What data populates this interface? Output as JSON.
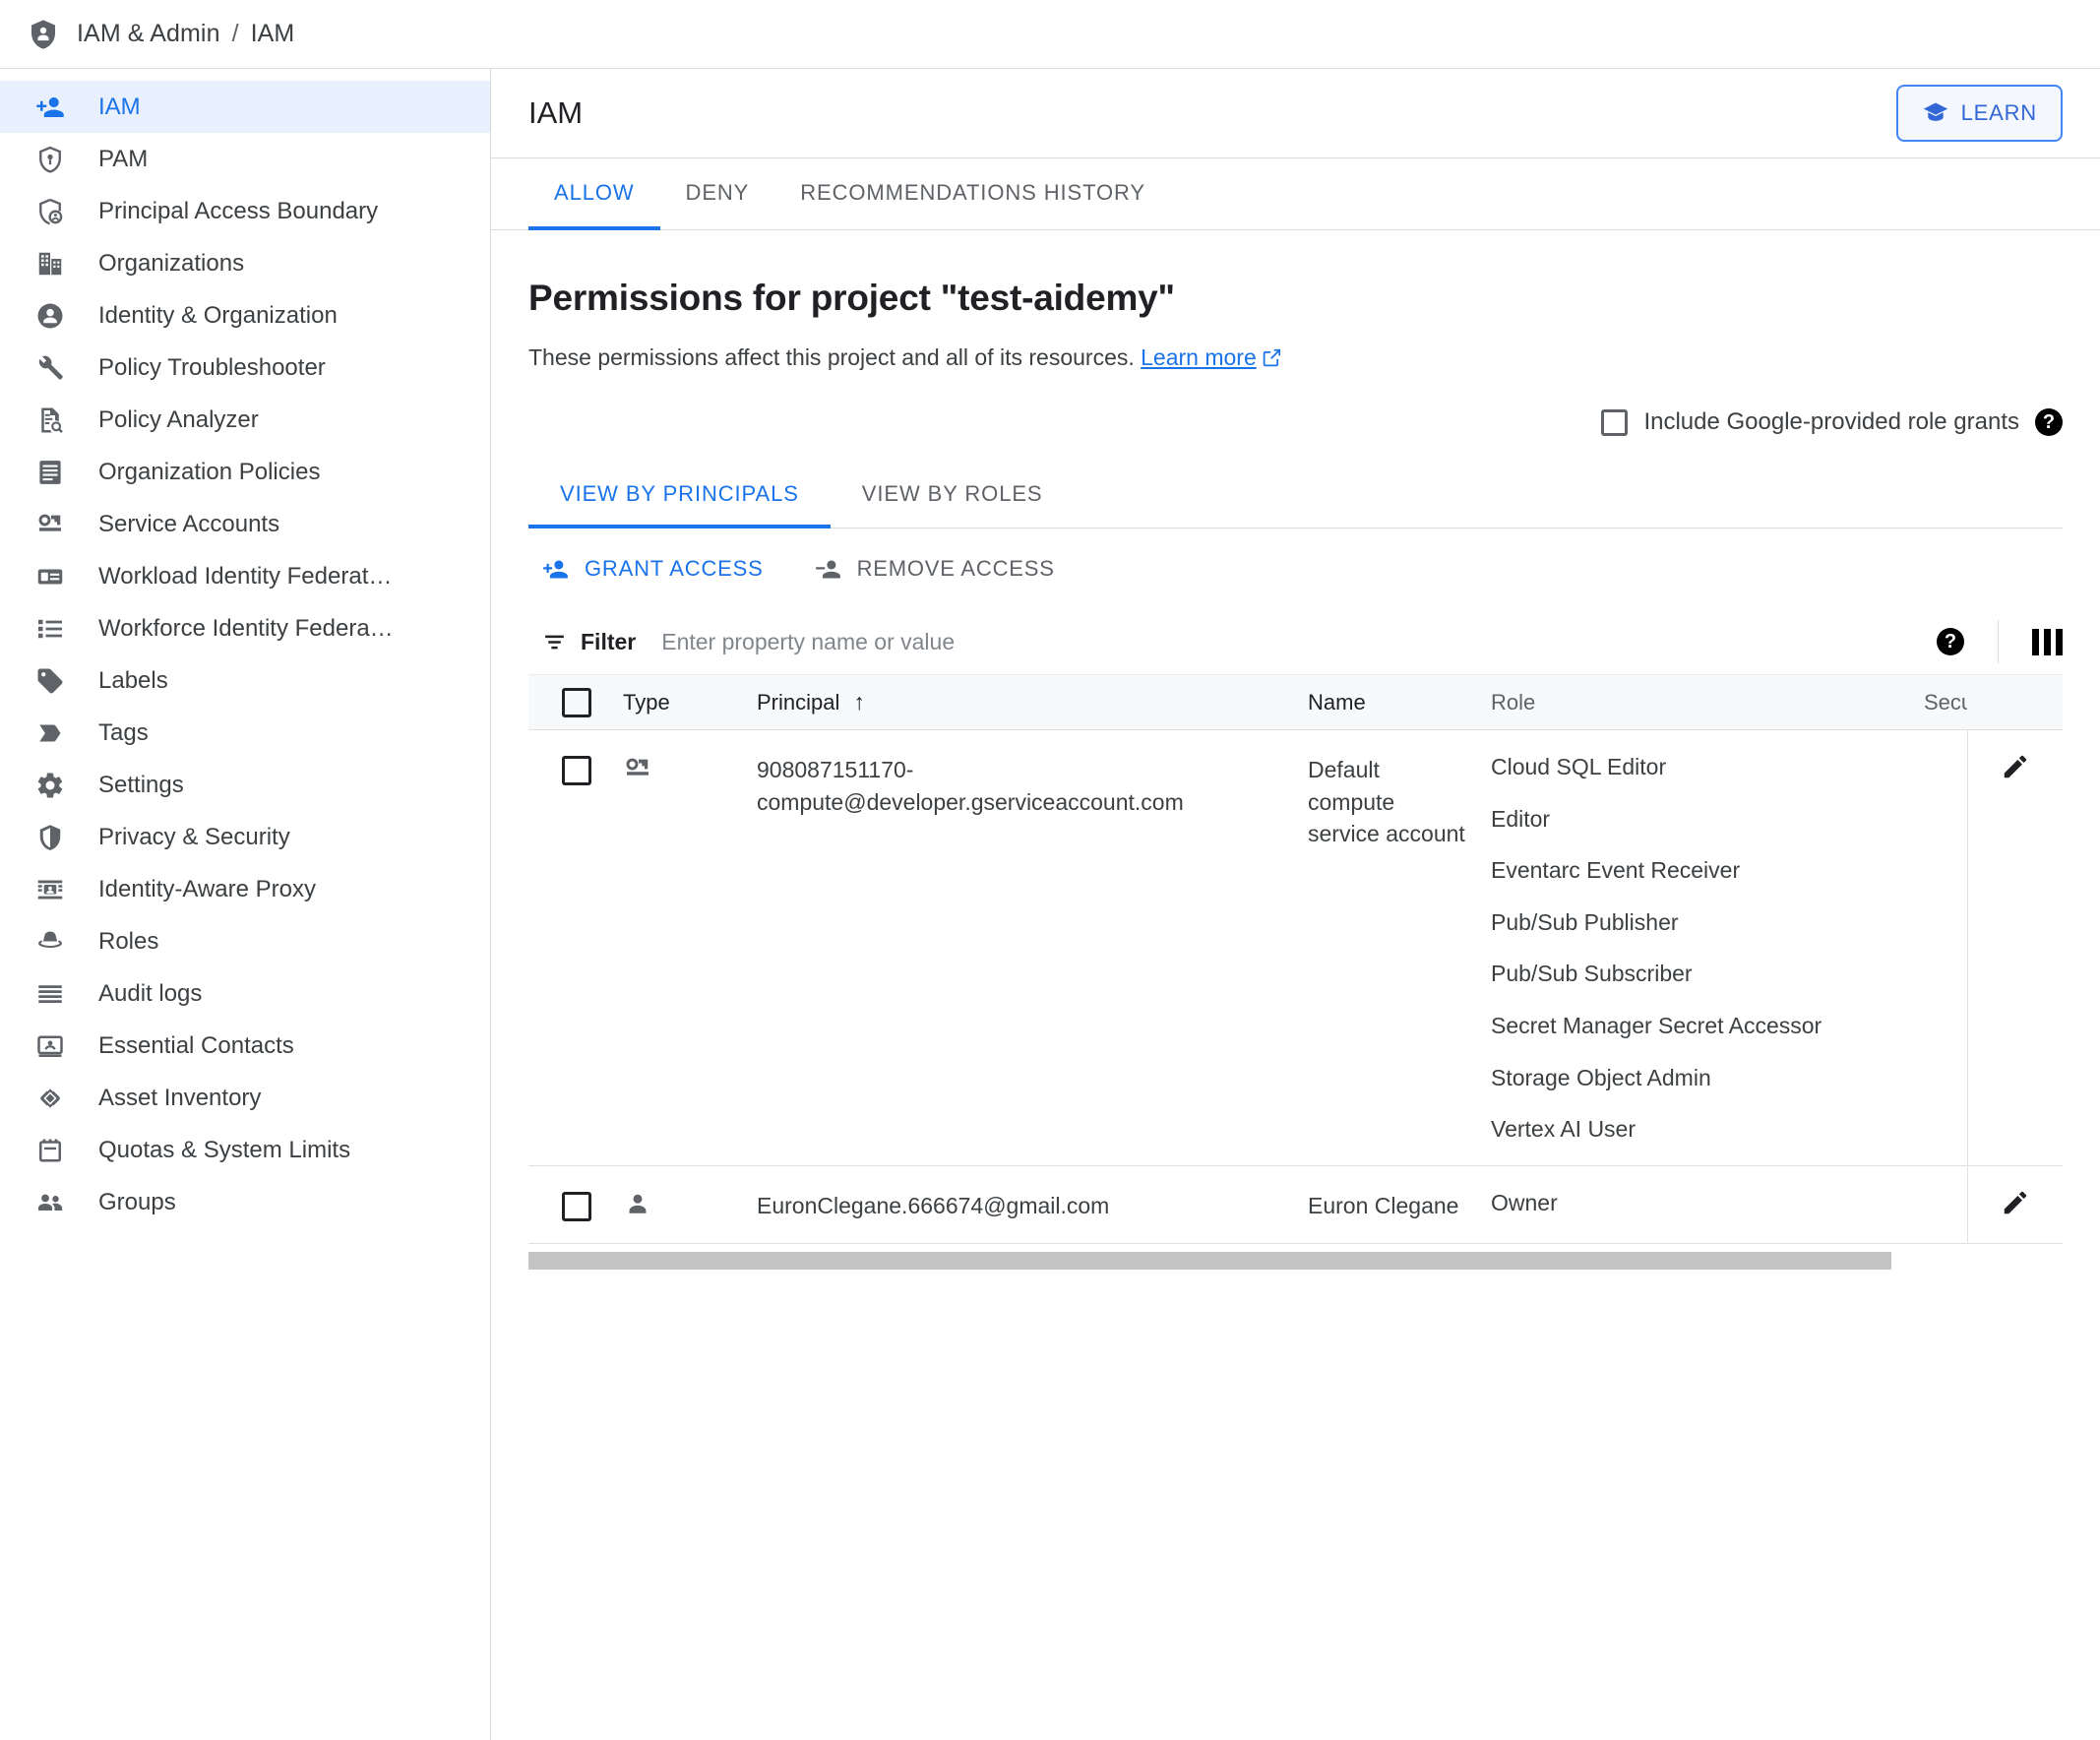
{
  "breadcrumb": {
    "icon": "shield-person-icon",
    "root": "IAM & Admin",
    "separator": "/",
    "current": "IAM"
  },
  "sidebar": {
    "items": [
      {
        "label": "IAM",
        "icon": "person-add-icon",
        "active": true
      },
      {
        "label": "PAM",
        "icon": "shield-key-icon",
        "active": false
      },
      {
        "label": "Principal Access Boundary",
        "icon": "shield-person-outline-icon",
        "active": false
      },
      {
        "label": "Organizations",
        "icon": "building-icon",
        "active": false
      },
      {
        "label": "Identity & Organization",
        "icon": "account-circle-icon",
        "active": false
      },
      {
        "label": "Policy Troubleshooter",
        "icon": "wrench-icon",
        "active": false
      },
      {
        "label": "Policy Analyzer",
        "icon": "document-search-icon",
        "active": false
      },
      {
        "label": "Organization Policies",
        "icon": "list-document-icon",
        "active": false
      },
      {
        "label": "Service Accounts",
        "icon": "key-card-icon",
        "active": false
      },
      {
        "label": "Workload Identity Federat…",
        "icon": "id-card-icon",
        "active": false
      },
      {
        "label": "Workforce Identity Federa…",
        "icon": "bulleted-list-icon",
        "active": false
      },
      {
        "label": "Labels",
        "icon": "tag-icon",
        "active": false
      },
      {
        "label": "Tags",
        "icon": "chevron-tag-icon",
        "active": false
      },
      {
        "label": "Settings",
        "icon": "gear-icon",
        "active": false
      },
      {
        "label": "Privacy & Security",
        "icon": "shield-icon",
        "active": false
      },
      {
        "label": "Identity-Aware Proxy",
        "icon": "proxy-icon",
        "active": false
      },
      {
        "label": "Roles",
        "icon": "hat-icon",
        "active": false
      },
      {
        "label": "Audit logs",
        "icon": "lines-icon",
        "active": false
      },
      {
        "label": "Essential Contacts",
        "icon": "contact-card-icon",
        "active": false
      },
      {
        "label": "Asset Inventory",
        "icon": "diamond-layers-icon",
        "active": false
      },
      {
        "label": "Quotas & System Limits",
        "icon": "notepad-icon",
        "active": false
      },
      {
        "label": "Groups",
        "icon": "people-icon",
        "active": false
      }
    ]
  },
  "header": {
    "title": "IAM",
    "learn_button": {
      "label": "LEARN",
      "icon": "graduation-cap-icon"
    }
  },
  "tabs": [
    {
      "label": "ALLOW",
      "active": true
    },
    {
      "label": "DENY",
      "active": false
    },
    {
      "label": "RECOMMENDATIONS HISTORY",
      "active": false
    }
  ],
  "permissions": {
    "title": "Permissions for project \"test-aidemy\"",
    "description": "These permissions affect this project and all of its resources.",
    "learn_more": "Learn more",
    "learn_more_icon": "external-link-icon",
    "google_grants": {
      "label": "Include Google-provided role grants",
      "checked": false,
      "help_icon": "help-icon"
    }
  },
  "subtabs": [
    {
      "label": "VIEW BY PRINCIPALS",
      "active": true
    },
    {
      "label": "VIEW BY ROLES",
      "active": false
    }
  ],
  "actions": [
    {
      "label": "GRANT ACCESS",
      "icon": "person-add-icon",
      "style": "primary"
    },
    {
      "label": "REMOVE ACCESS",
      "icon": "person-remove-icon",
      "style": "muted"
    }
  ],
  "filter": {
    "label": "Filter",
    "icon": "filter-icon",
    "placeholder": "Enter property name or value",
    "value": "",
    "help_icon": "help-icon",
    "columns_icon": "columns-icon"
  },
  "table": {
    "columns": [
      "Type",
      "Principal",
      "Name",
      "Role",
      "Security"
    ],
    "sort_column": "Principal",
    "sort_direction": "asc",
    "sort_icon": "arrow-up-icon",
    "header_checkbox_checked": false,
    "rows": [
      {
        "checked": false,
        "type_icon": "service-account-key-icon",
        "principal": "908087151170-compute@developer.gserviceaccount.com",
        "name": "Default compute service account",
        "roles": [
          "Cloud SQL Editor",
          "Editor",
          "Eventarc Event Receiver",
          "Pub/Sub Publisher",
          "Pub/Sub Subscriber",
          "Secret Manager Secret Accessor",
          "Storage Object Admin",
          "Vertex AI User"
        ],
        "security": "",
        "edit_icon": "edit-pencil-icon"
      },
      {
        "checked": false,
        "type_icon": "user-icon",
        "principal": "EuronClegane.666674@gmail.com",
        "name": "Euron Clegane",
        "roles": [
          "Owner"
        ],
        "security": "",
        "edit_icon": "edit-pencil-icon"
      }
    ]
  },
  "colors": {
    "accent_blue": "#1a73e8",
    "active_nav_bg": "#e8f0fe",
    "text_primary": "#202124",
    "text_secondary": "#5f6368",
    "border": "#dadce0"
  }
}
